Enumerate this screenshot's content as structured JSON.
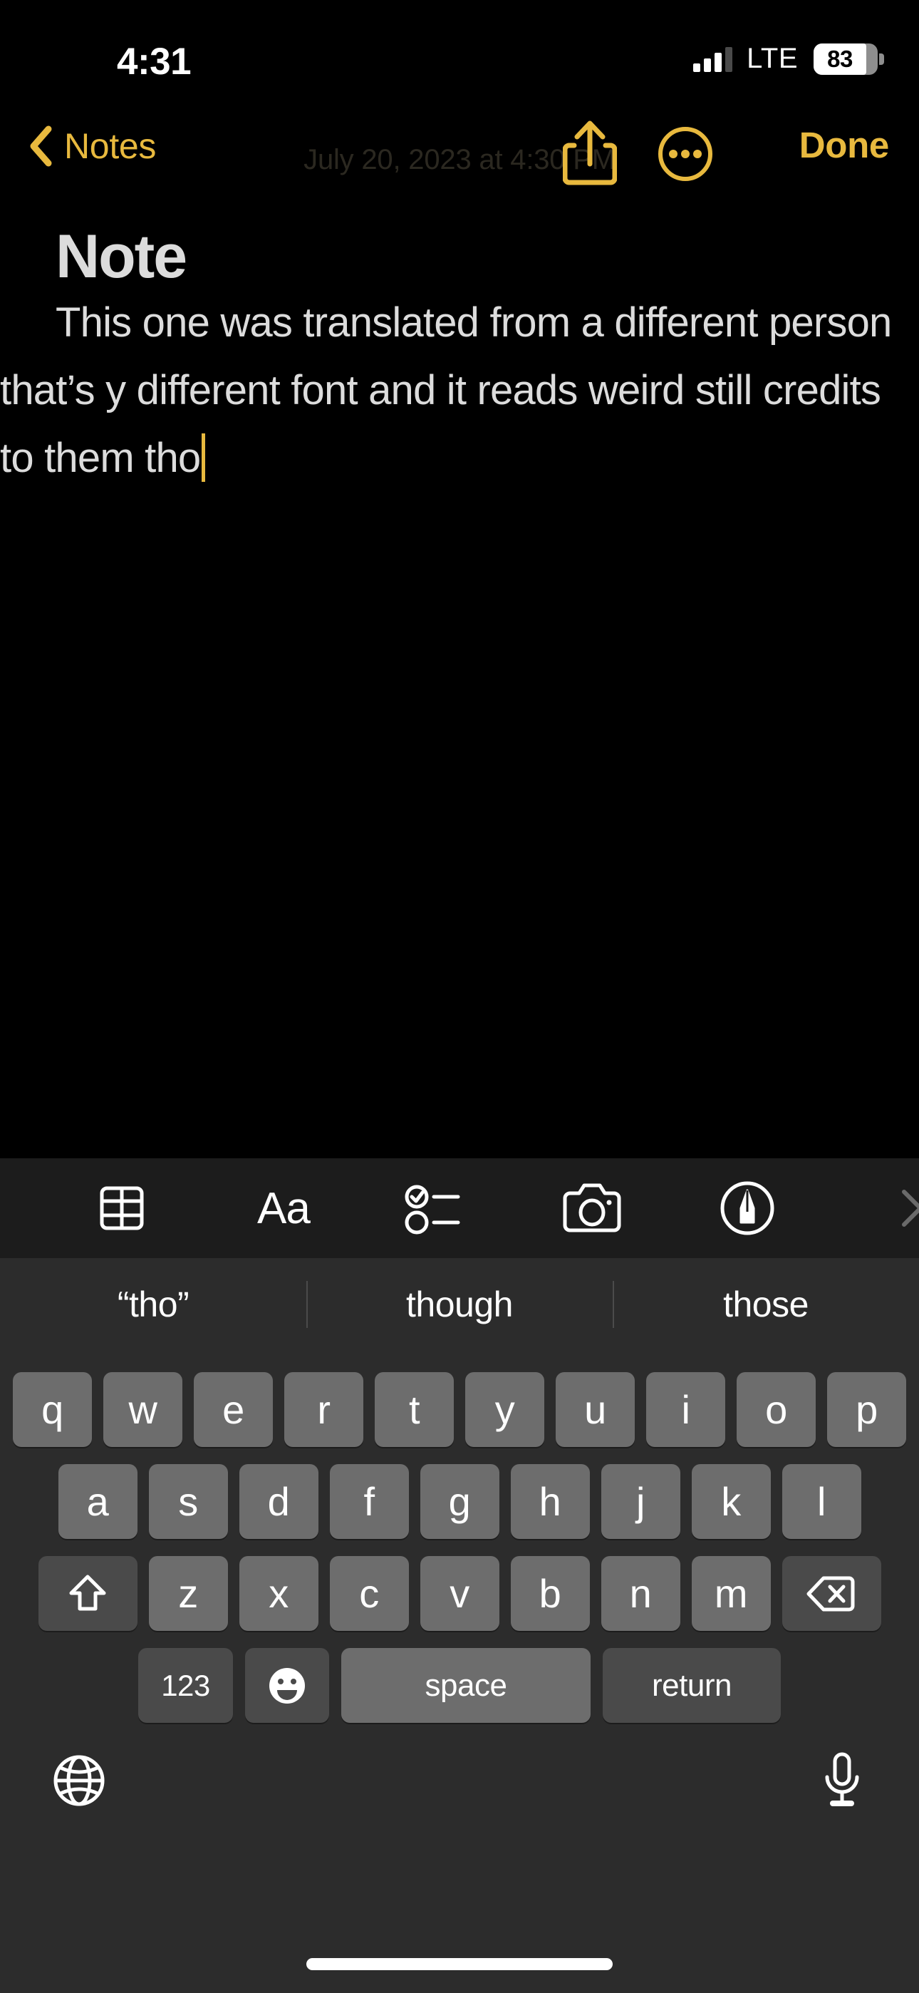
{
  "status_bar": {
    "time": "4:31",
    "carrier_tech": "LTE",
    "battery_percent": "83",
    "signal_bars_filled": 3,
    "signal_bars_total": 4
  },
  "nav_bar": {
    "back_label": "Notes",
    "back_icon": "chevron-left-icon",
    "date_label": "July 20, 2023 at 4:30 PM",
    "share_icon": "share-icon",
    "more_icon": "ellipsis-circle-icon",
    "done_label": "Done",
    "accent_color": "#E8B93E"
  },
  "note": {
    "title": "Note",
    "body": "This one was translated from a different person that’s y different font and it reads weird still credits to them tho",
    "caret_color": "#E8B93E",
    "text_color": "#DCDCDC"
  },
  "format_toolbar": {
    "background": "#1C1C1C",
    "items": [
      {
        "name": "table-icon",
        "label": ""
      },
      {
        "name": "text-format-icon",
        "label": "Aa"
      },
      {
        "name": "checklist-icon",
        "label": ""
      },
      {
        "name": "camera-icon",
        "label": ""
      },
      {
        "name": "markup-pen-icon",
        "label": ""
      },
      {
        "name": "close-icon",
        "label": ""
      }
    ]
  },
  "keyboard": {
    "background": "#2C2C2C",
    "key_color": "#6D6D6D",
    "key_dark_color": "#4A4A4A",
    "predictions": [
      "“tho”",
      "though",
      "those"
    ],
    "row1": [
      "q",
      "w",
      "e",
      "r",
      "t",
      "y",
      "u",
      "i",
      "o",
      "p"
    ],
    "row2": [
      "a",
      "s",
      "d",
      "f",
      "g",
      "h",
      "j",
      "k",
      "l"
    ],
    "row3": [
      "z",
      "x",
      "c",
      "v",
      "b",
      "n",
      "m"
    ],
    "shift_icon": "shift-arrow-icon",
    "delete_icon": "backspace-icon",
    "numbers_label": "123",
    "emoji_icon": "emoji-smiley-icon",
    "space_label": "space",
    "return_label": "return",
    "globe_icon": "globe-icon",
    "mic_icon": "microphone-icon"
  }
}
